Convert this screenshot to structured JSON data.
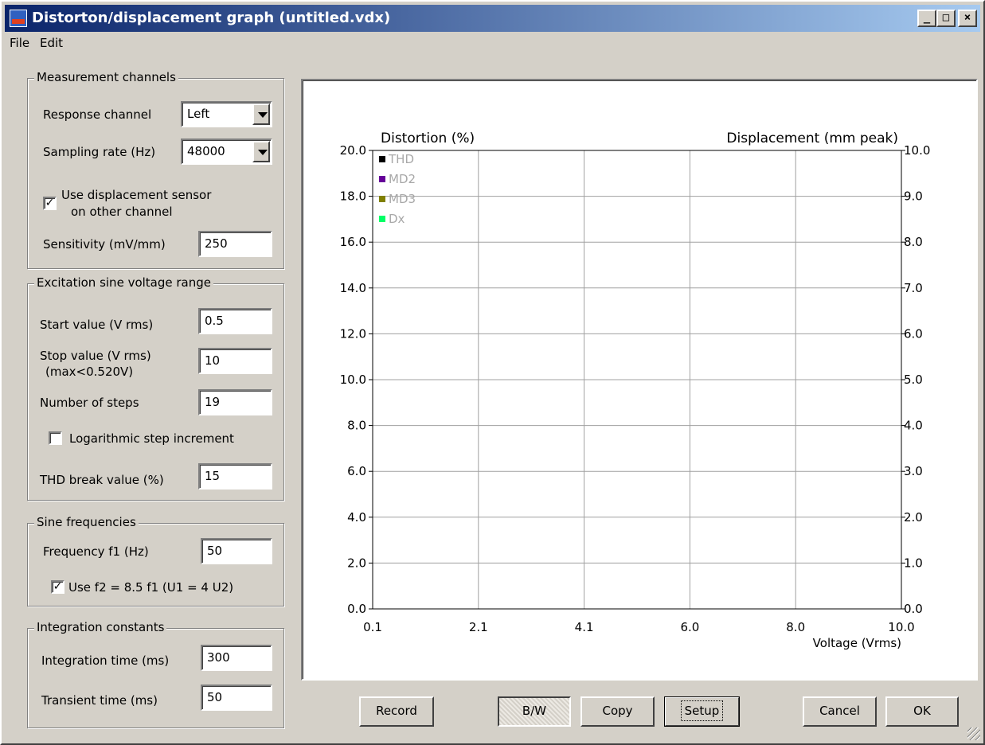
{
  "window": {
    "title": "Distorton/displacement graph (untitled.vdx)",
    "controls": [
      "_",
      "□",
      "×"
    ]
  },
  "menu": {
    "file": "File",
    "edit": "Edit"
  },
  "measurement": {
    "legend": "Measurement channels",
    "response_label": "Response channel",
    "response_value": "Left",
    "sampling_label": "Sampling rate (Hz)",
    "sampling_value": "48000",
    "use_disp_line1": "Use displacement sensor",
    "use_disp_line2": "on other channel",
    "use_disp_checked": true,
    "sensitivity_label": "Sensitivity (mV/mm)",
    "sensitivity_value": "250"
  },
  "excitation": {
    "legend": "Excitation sine voltage range",
    "start_label": "Start value (V rms)",
    "start_value": "0.5",
    "stop_label": "Stop value (V rms)",
    "stop_sub": "(max<0.520V)",
    "stop_value": "10",
    "steps_label": "Number of steps",
    "steps_value": "19",
    "log_label": "Logarithmic step  increment",
    "log_checked": false,
    "thd_label": "THD break value (%)",
    "thd_value": "15"
  },
  "sine": {
    "legend": "Sine frequencies",
    "f1_label": "Frequency f1 (Hz)",
    "f1_value": "50",
    "f2_label": "Use f2 =  8.5 f1  (U1 = 4 U2)",
    "f2_checked": true
  },
  "integration": {
    "legend": "Integration constants",
    "int_label": "Integration time (ms)",
    "int_value": "300",
    "trans_label": "Transient time (ms)",
    "trans_value": "50"
  },
  "buttons": {
    "record": "Record",
    "bw": "B/W",
    "copy": "Copy",
    "setup": "Setup",
    "cancel": "Cancel",
    "ok": "OK"
  },
  "chart_data": {
    "type": "line",
    "ylabel_left": "Distortion (%)",
    "ylabel_right": "Displacement (mm peak)",
    "xlabel": "Voltage (Vrms)",
    "x_ticks": [
      "0.1",
      "2.1",
      "4.1",
      "6.0",
      "8.0",
      "10.0"
    ],
    "y_left_ticks": [
      "0.0",
      "2.0",
      "4.0",
      "6.0",
      "8.0",
      "10.0",
      "12.0",
      "14.0",
      "16.0",
      "18.0",
      "20.0"
    ],
    "y_right_ticks": [
      "0.0",
      "1.0",
      "2.0",
      "3.0",
      "4.0",
      "5.0",
      "6.0",
      "7.0",
      "8.0",
      "9.0",
      "10.0"
    ],
    "xlim": [
      0.1,
      10.0
    ],
    "ylim_left": [
      0,
      20
    ],
    "ylim_right": [
      0,
      10
    ],
    "grid": true,
    "legend_position": "top-left",
    "series": [
      {
        "name": "THD",
        "color": "#000000",
        "values": []
      },
      {
        "name": "MD2",
        "color": "#660099",
        "values": []
      },
      {
        "name": "MD3",
        "color": "#808000",
        "values": []
      },
      {
        "name": "Dx",
        "color": "#00ff66",
        "values": []
      }
    ]
  }
}
